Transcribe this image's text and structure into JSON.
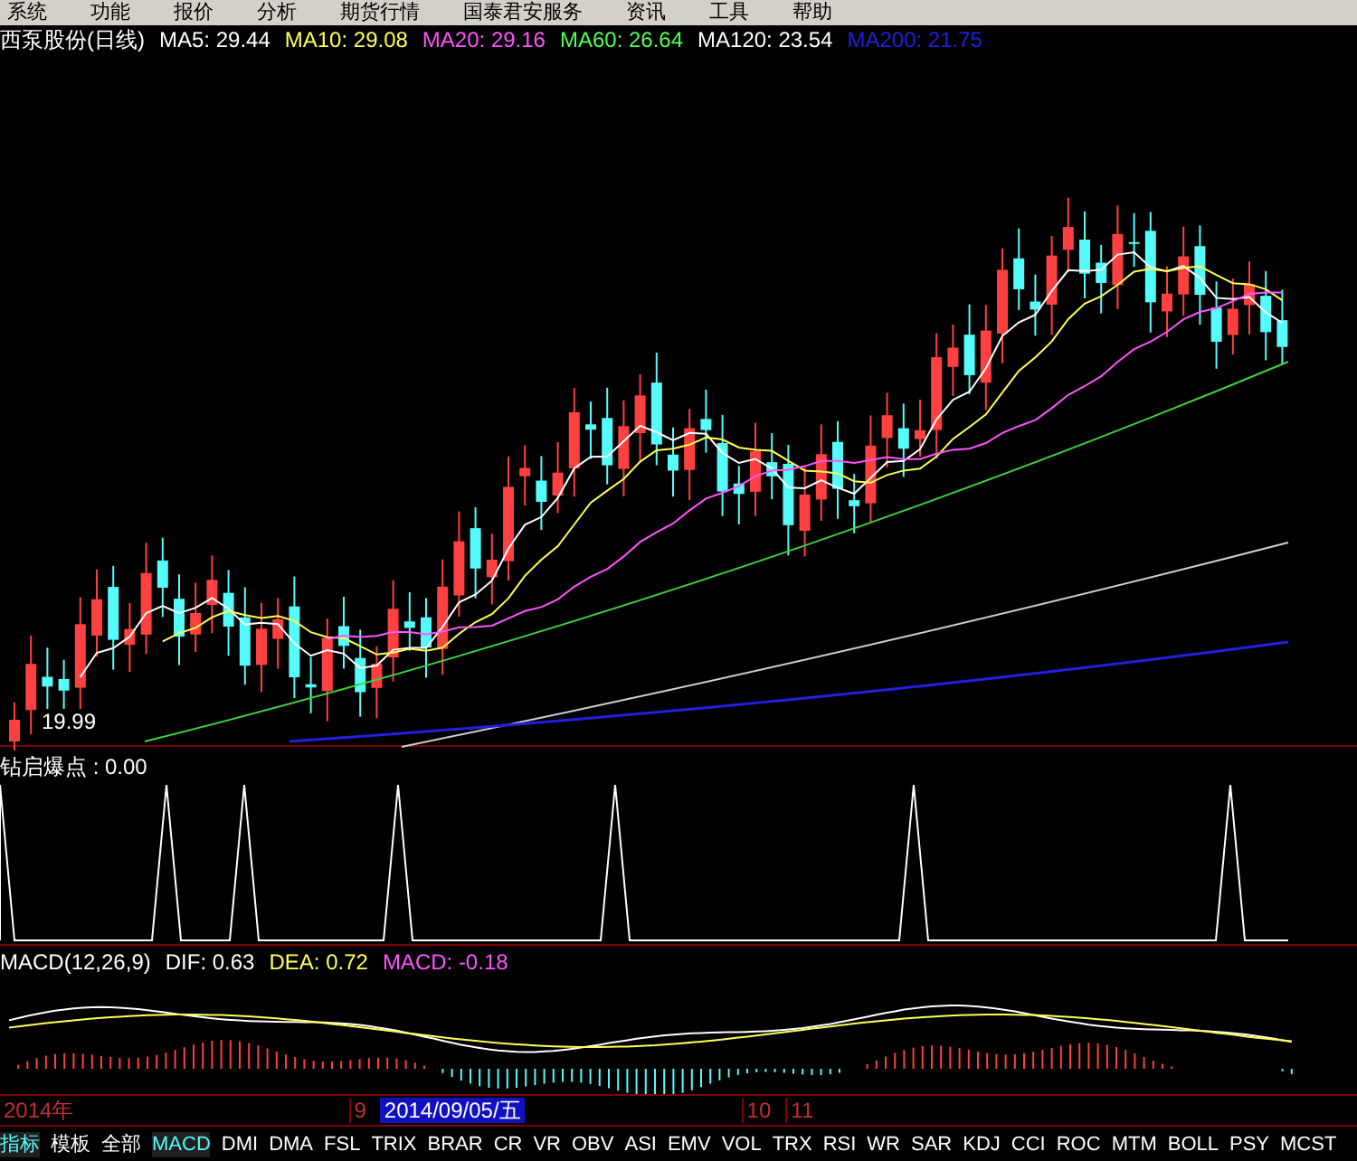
{
  "menu": [
    "系统",
    "功能",
    "报价",
    "分析",
    "期货行情",
    "国泰君安服务",
    "资讯",
    "工具",
    "帮助"
  ],
  "main_panel": {
    "title": "西泵股份(日线)",
    "ma_legend": [
      {
        "label": "MA5: 29.44",
        "color": "#ffffff"
      },
      {
        "label": "MA10: 29.08",
        "color": "#ffff54"
      },
      {
        "label": "MA20: 29.16",
        "color": "#ff54ff"
      },
      {
        "label": "MA60: 26.64",
        "color": "#54ff54"
      },
      {
        "label": "MA120: 23.54",
        "color": "#ffffff"
      },
      {
        "label": "MA200: 21.75",
        "color": "#2020e0"
      }
    ],
    "low_label": "19.99"
  },
  "signal_panel": {
    "label": "钻启爆点 : 0.00"
  },
  "macd_panel": {
    "legend": [
      {
        "label": "MACD(12,26,9)",
        "color": "#ffffff"
      },
      {
        "label": "DIF: 0.63",
        "color": "#ffffff"
      },
      {
        "label": "DEA: 0.72",
        "color": "#ffff54"
      },
      {
        "label": "MACD: -0.18",
        "color": "#ff54ff"
      }
    ]
  },
  "date_axis": [
    {
      "label": "2014年",
      "selected": false
    },
    {
      "label": "9",
      "selected": false
    },
    {
      "label": "2014/09/05/五",
      "selected": true
    },
    {
      "label": "10",
      "selected": false
    },
    {
      "label": "11",
      "selected": false
    }
  ],
  "bottom_tabs": [
    {
      "label": "指标",
      "selected": true
    },
    {
      "label": "模板",
      "selected": false
    },
    {
      "label": "全部",
      "selected": false
    },
    {
      "label": "MACD",
      "selected": true
    },
    {
      "label": "DMI",
      "selected": false
    },
    {
      "label": "DMA",
      "selected": false
    },
    {
      "label": "FSL",
      "selected": false
    },
    {
      "label": "TRIX",
      "selected": false
    },
    {
      "label": "BRAR",
      "selected": false
    },
    {
      "label": "CR",
      "selected": false
    },
    {
      "label": "VR",
      "selected": false
    },
    {
      "label": "OBV",
      "selected": false
    },
    {
      "label": "ASI",
      "selected": false
    },
    {
      "label": "EMV",
      "selected": false
    },
    {
      "label": "VOL",
      "selected": false
    },
    {
      "label": "TRX",
      "selected": false
    },
    {
      "label": "RSI",
      "selected": false
    },
    {
      "label": "WR",
      "selected": false
    },
    {
      "label": "SAR",
      "selected": false
    },
    {
      "label": "KDJ",
      "selected": false
    },
    {
      "label": "CCI",
      "selected": false
    },
    {
      "label": "ROC",
      "selected": false
    },
    {
      "label": "MTM",
      "selected": false
    },
    {
      "label": "BOLL",
      "selected": false
    },
    {
      "label": "PSY",
      "selected": false
    },
    {
      "label": "MCST",
      "selected": false
    }
  ]
}
